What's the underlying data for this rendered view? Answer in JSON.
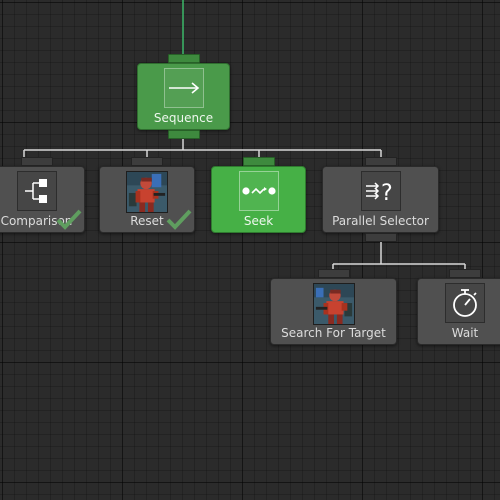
{
  "nodes": {
    "sequence": {
      "label": "Sequence",
      "icon": "arrow-right-icon",
      "color": "#4a9a4a"
    },
    "comparison": {
      "label": "Comparison",
      "icon": "branch-icon",
      "status": "success",
      "status_icon": "checkmark-icon"
    },
    "reset": {
      "label": "Reset",
      "icon": "soldier-avatar",
      "status": "success",
      "status_icon": "checkmark-icon"
    },
    "seek": {
      "label": "Seek",
      "icon": "path-dots-icon",
      "color": "#46b046"
    },
    "parallel_selector": {
      "label": "Parallel Selector",
      "icon": "parallel-selector-icon"
    },
    "search_for_target": {
      "label": "Search For Target",
      "icon": "soldier-avatar"
    },
    "wait": {
      "label": "Wait",
      "icon": "stopwatch-icon"
    }
  },
  "colors": {
    "canvas": "#2b2b2b",
    "node": "#505050",
    "active_node": "#4a9a4a",
    "connection": "#d8d8d8",
    "active_connection": "#3cba6a",
    "success_check": "#5f9e5f"
  }
}
